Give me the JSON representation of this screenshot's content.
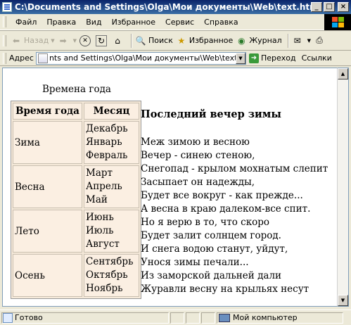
{
  "window": {
    "title": "C:\\Documents and Settings\\Olga\\Мои документы\\Web\\text.html - Microsoft Internet Explorer",
    "controls": {
      "minimize": "_",
      "maximize": "□",
      "close": "×"
    }
  },
  "menu": {
    "items": [
      "Файл",
      "Правка",
      "Вид",
      "Избранное",
      "Сервис",
      "Справка"
    ]
  },
  "toolbar": {
    "back": "Назад",
    "search": "Поиск",
    "favorites": "Избранное",
    "journal": "Журнал"
  },
  "address": {
    "label": "Адрес",
    "value": "nts and Settings\\Olga\\Мои документы\\Web\\text.html",
    "go": "Переход",
    "links": "Ссылки"
  },
  "page": {
    "table_caption": "Времена года",
    "headers": [
      "Время года",
      "Месяц"
    ],
    "seasons": [
      {
        "name": "Зима",
        "months": [
          "Декабрь",
          "Январь",
          "Февраль"
        ]
      },
      {
        "name": "Весна",
        "months": [
          "Март",
          "Апрель",
          "Май"
        ]
      },
      {
        "name": "Лето",
        "months": [
          "Июнь",
          "Июль",
          "Август"
        ]
      },
      {
        "name": "Осень",
        "months": [
          "Сентябрь",
          "Октябрь",
          "Ноябрь"
        ]
      }
    ],
    "poem_title": "Последний вечер зимы",
    "poem_lines": [
      "Меж зимою и весною",
      "Вечер - синею стеною,",
      "Снегопад - крылом мохнатым слепит",
      "Засыпает он надежды,",
      "Будет все вокруг - как прежде...",
      "А весна в краю далеком-все спит.",
      "Но я верю в то, что скоро",
      "Будет залит солнцем город.",
      "И снега водою станут, уйдут,",
      "Унося зимы печали...",
      "Из заморской дальней дали",
      "Журавли весну на крыльях несут"
    ]
  },
  "status": {
    "text": "Готово",
    "zone": "Мой компьютер"
  },
  "colors": {
    "titlebar": "#0A246A",
    "chrome": "#ECE9D8",
    "table_cell": "#FBEFE2"
  }
}
